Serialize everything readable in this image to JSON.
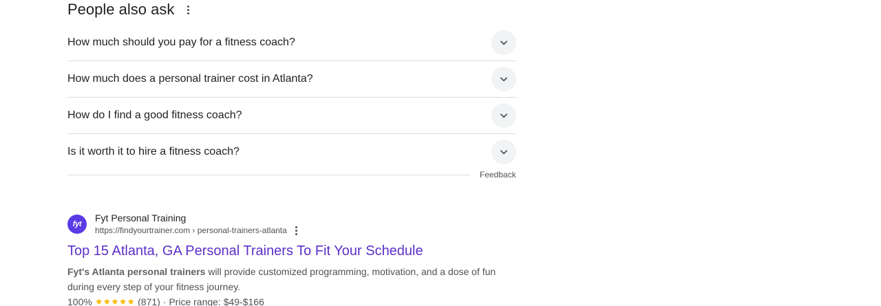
{
  "paa": {
    "title": "People also ask",
    "more_icon": "more-vert-icon",
    "questions": [
      "How much should you pay for a fitness coach?",
      "How much does a personal trainer cost in Atlanta?",
      "How do I find a good fitness coach?",
      "Is it worth it to hire a fitness coach?"
    ],
    "expand_icon": "chevron-down-icon",
    "feedback_label": "Feedback"
  },
  "result": {
    "favicon_text": "fyt",
    "favicon_color": "#5b3be6",
    "site_name": "Fyt Personal Training",
    "url": "https://findyourtrainer.com › personal-trainers-atlanta",
    "title": "Top 15 Atlanta, GA Personal Trainers To Fit Your Schedule",
    "title_color": "#5a2fc8",
    "snippet_bold": "Fyt's Atlanta personal trainers",
    "snippet_rest_line1": " will provide customized programming, motivation, and a dose of fun",
    "snippet_rest_line2": "during every step of your fitness journey.",
    "rating_percent": "100%",
    "stars": "★★★★★",
    "star_color": "#fbbc04",
    "rating_count": "(871)",
    "price_range": "· Price range: $49-$166"
  }
}
